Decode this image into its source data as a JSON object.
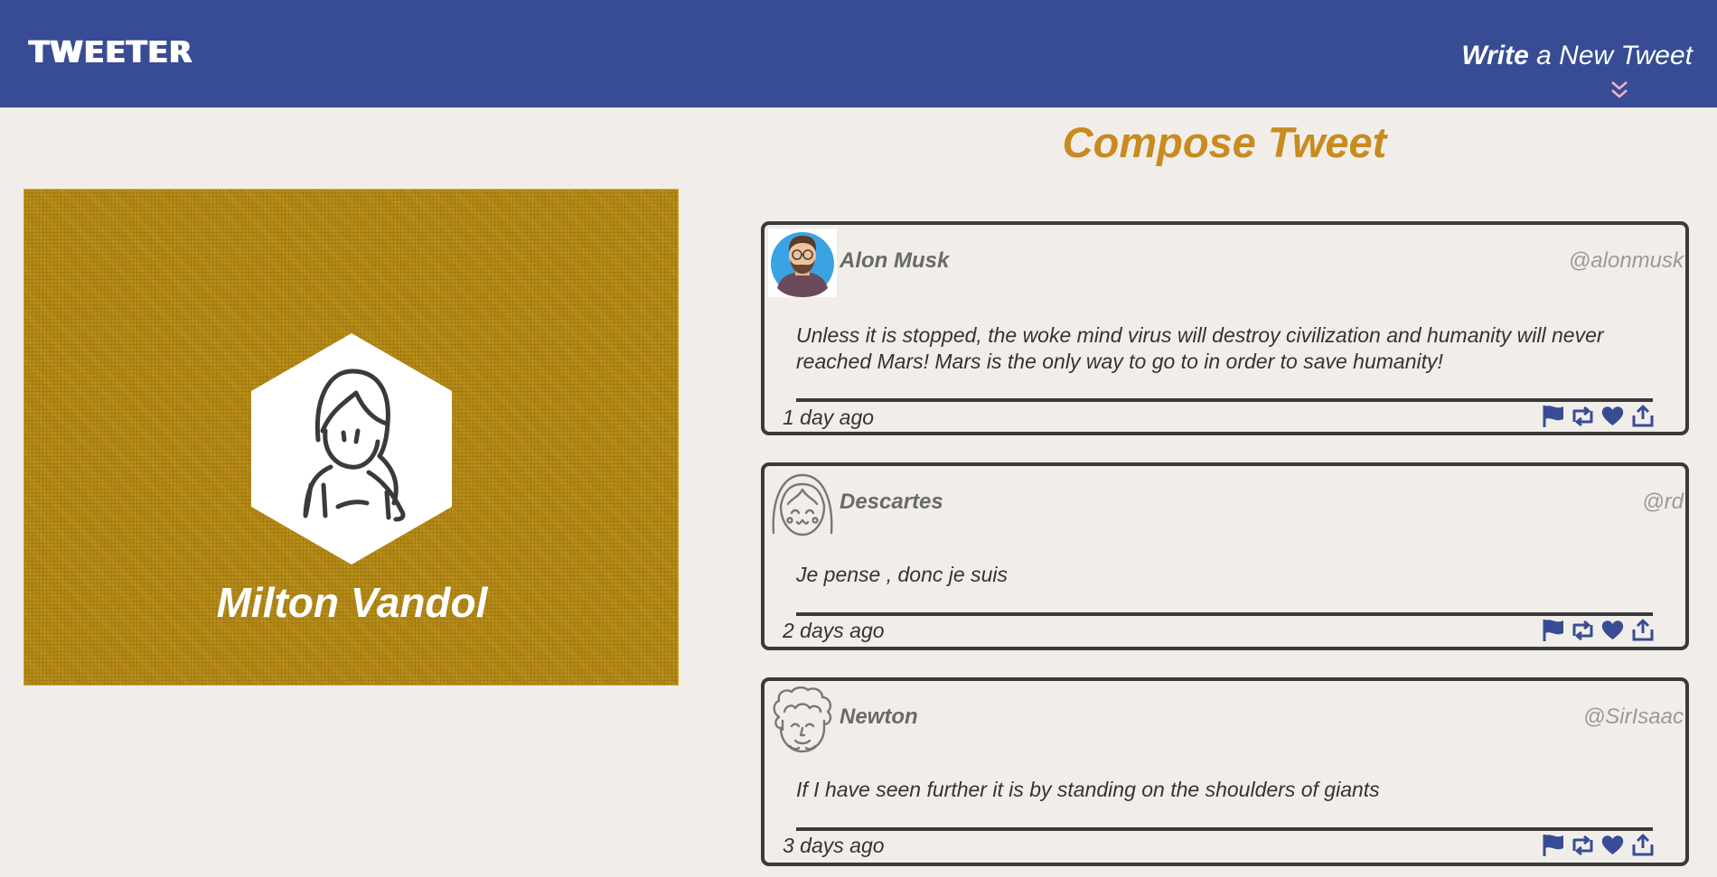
{
  "nav": {
    "brand": "TWEETER",
    "compose_bold": "Write",
    "compose_rest": " a New Tweet"
  },
  "profile": {
    "name": "Milton Vandol"
  },
  "compose": {
    "heading": "Compose Tweet"
  },
  "tweets": [
    {
      "name": "Alon Musk",
      "handle": "@alonmusk",
      "text": "Unless it is stopped, the woke mind virus will destroy civilization and humanity will never reached Mars! Mars is the only way to go to in order to save humanity!",
      "time": "1 day ago"
    },
    {
      "name": "Descartes",
      "handle": "@rd",
      "text": "Je pense , donc je suis",
      "time": "2 days ago"
    },
    {
      "name": "Newton",
      "handle": "@SirIsaac",
      "text": "If I have seen further it is by standing on the shoulders of giants",
      "time": "3 days ago"
    }
  ],
  "icons": {
    "actions": [
      "flag-icon",
      "retweet-icon",
      "heart-icon",
      "share-icon"
    ],
    "compose_chevron": "double-chevron-down-icon"
  },
  "colors": {
    "nav": "#384c96",
    "accent": "#c98b1f",
    "profile_bg": "#b38a17",
    "background": "#f1eeea"
  }
}
